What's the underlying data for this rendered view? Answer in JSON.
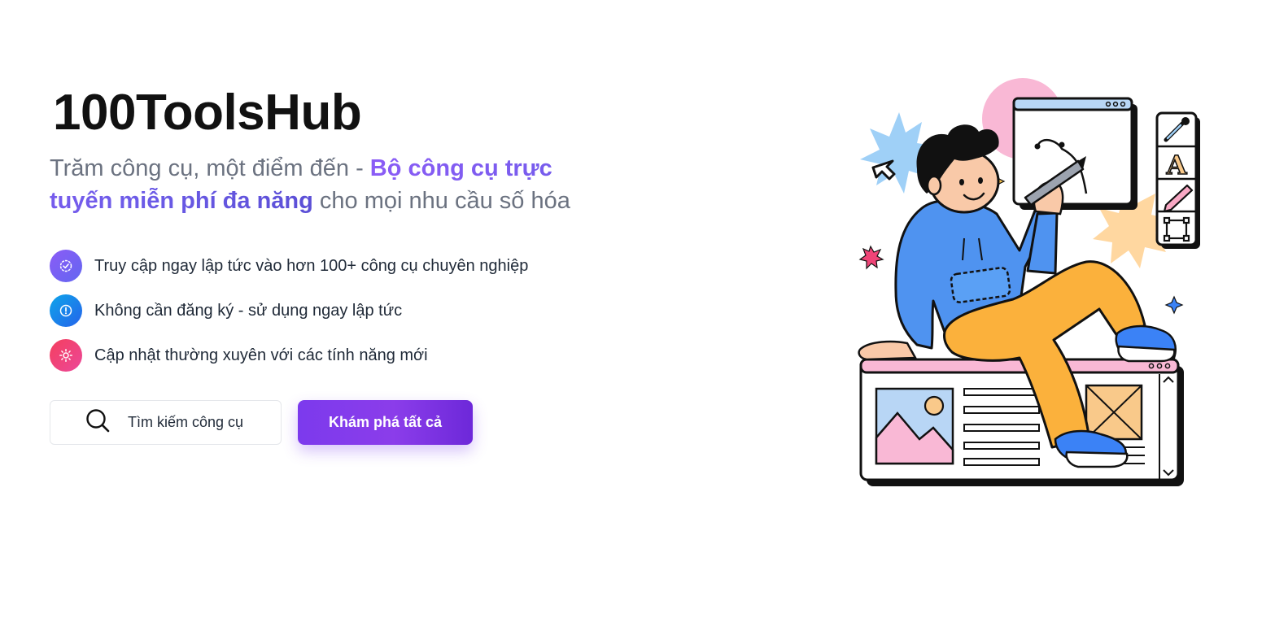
{
  "hero": {
    "title": "100ToolsHub",
    "tagline_prefix": "Trăm công cụ, một điểm đến - ",
    "tagline_highlight": "Bộ công cụ trực tuyến miễn phí đa năng",
    "tagline_suffix": " cho mọi nhu cầu số hóa"
  },
  "features": [
    {
      "icon": "check-badge-icon",
      "text": "Truy cập ngay lập tức vào hơn 100+ công cụ chuyên nghiệp"
    },
    {
      "icon": "alert-circle-icon",
      "text": "Không cần đăng ký - sử dụng ngay lập tức"
    },
    {
      "icon": "sun-icon",
      "text": "Cập nhật thường xuyên với các tính năng mới"
    }
  ],
  "actions": {
    "search_label": "Tìm kiếm công cụ",
    "explore_label": "Khám phá tất cả"
  },
  "colors": {
    "accent": "#7c3aed",
    "highlight_text": "#6d5ce8",
    "feature_purple": "#8b5cf6",
    "feature_blue": "#0ea5e9",
    "feature_pink": "#f43f5e"
  }
}
